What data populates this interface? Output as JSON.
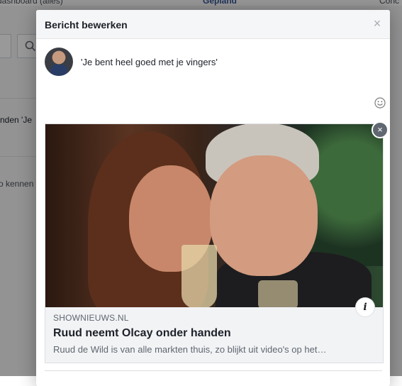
{
  "background": {
    "tabs": [
      {
        "label": "dashboard (alles)"
      },
      {
        "label": "Gepland"
      },
      {
        "label": "Conc"
      }
    ],
    "snippet_1": "nden 'Je",
    "snippet_2": "o kennen"
  },
  "dialog": {
    "title": "Bericht bewerken",
    "close_symbol": "×",
    "post_text": "'Je bent heel goed met je vingers'",
    "attachment": {
      "remove_symbol": "×",
      "info_symbol": "i",
      "domain": "SHOWNIEUWS.NL",
      "headline": "Ruud neemt Olcay onder handen",
      "description": "Ruud de Wild is van alle markten thuis, zo blijkt uit video's op het…"
    }
  },
  "colors": {
    "header_bg": "#f5f6f7",
    "text_primary": "#1d2129",
    "text_secondary": "#606770",
    "tab_active": "#365899"
  },
  "icons": [
    "search-icon",
    "close-icon",
    "emoji-icon",
    "info-icon"
  ]
}
